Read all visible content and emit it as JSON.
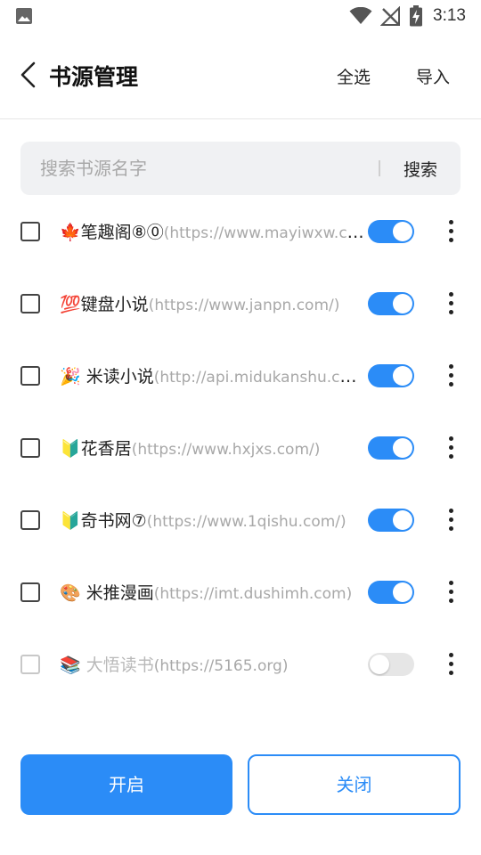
{
  "status_bar": {
    "time": "3:13",
    "icons": [
      "image-icon",
      "wifi-icon",
      "no-signal-icon",
      "battery-charging-icon"
    ]
  },
  "header": {
    "title": "书源管理",
    "select_all": "全选",
    "import": "导入"
  },
  "search": {
    "placeholder": "搜索书源名字",
    "button": "搜索"
  },
  "sources": [
    {
      "emoji": "🍁",
      "name": "笔趣阁⑧⓪",
      "url": "(https://www.mayiwxw.com/)",
      "enabled": true
    },
    {
      "emoji": "💯",
      "name": "键盘小说",
      "url": "(https://www.janpn.com/)",
      "enabled": true
    },
    {
      "emoji": "🎉",
      "name": " 米读小说",
      "url": "(http://api.midukanshu.com/)",
      "enabled": true
    },
    {
      "emoji": "🔰",
      "name": "花香居",
      "url": "(https://www.hxjxs.com/)",
      "enabled": true
    },
    {
      "emoji": "🔰",
      "name": "奇书网⑦",
      "url": "(https://www.1qishu.com/)",
      "enabled": true
    },
    {
      "emoji": "🎨",
      "name": " 米推漫画",
      "url": "(https://imt.dushimh.com)",
      "enabled": true
    },
    {
      "emoji": "📚",
      "name": " 大悟读书",
      "url": "(https://5165.org)",
      "enabled": false
    }
  ],
  "footer": {
    "open": "开启",
    "close": "关闭"
  },
  "colors": {
    "accent": "#2b8cf7",
    "toggle_off": "#e6e6e6",
    "url_text": "#a8a8a8"
  }
}
